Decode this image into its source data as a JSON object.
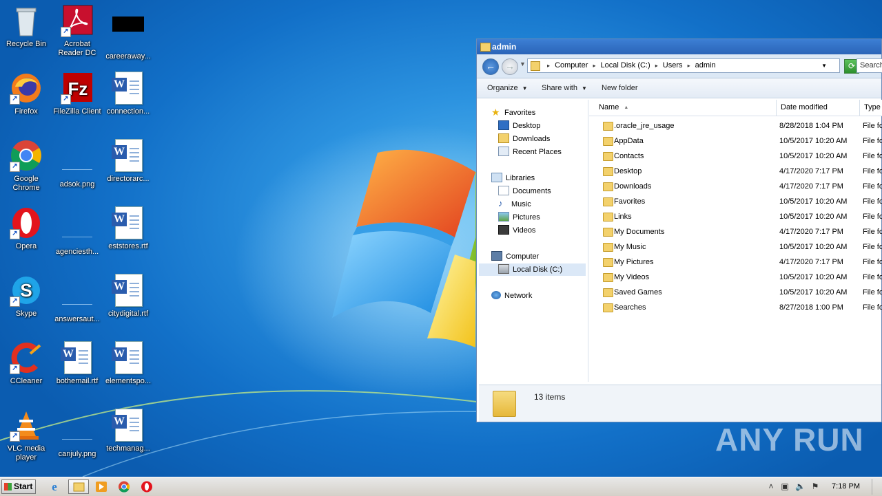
{
  "desktop": {
    "icons": [
      {
        "label": "Recycle Bin"
      },
      {
        "label": "Acrobat Reader DC"
      },
      {
        "label": "careeraway..."
      },
      {
        "label": "Firefox"
      },
      {
        "label": "FileZilla Client"
      },
      {
        "label": "connection..."
      },
      {
        "label": "Google Chrome"
      },
      {
        "label": "adsok.png"
      },
      {
        "label": "directorarc..."
      },
      {
        "label": "Opera"
      },
      {
        "label": "agenciesth..."
      },
      {
        "label": "eststores.rtf"
      },
      {
        "label": "Skype"
      },
      {
        "label": "answersaut..."
      },
      {
        "label": "citydigital.rtf"
      },
      {
        "label": "CCleaner"
      },
      {
        "label": "bothemail.rtf"
      },
      {
        "label": "elementspo..."
      },
      {
        "label": "VLC media player"
      },
      {
        "label": "canjuly.png"
      },
      {
        "label": "techmanag..."
      }
    ]
  },
  "explorer": {
    "title": "admin",
    "breadcrumbs": [
      "Computer",
      "Local Disk (C:)",
      "Users",
      "admin"
    ],
    "search_placeholder": "Search",
    "toolbar": {
      "organize": "Organize",
      "share_with": "Share with",
      "new_folder": "New folder"
    },
    "nav": {
      "favorites": "Favorites",
      "desktop": "Desktop",
      "downloads": "Downloads",
      "recent_places": "Recent Places",
      "libraries": "Libraries",
      "documents": "Documents",
      "music": "Music",
      "pictures": "Pictures",
      "videos": "Videos",
      "computer": "Computer",
      "local_disk": "Local Disk (C:)",
      "network": "Network"
    },
    "columns": {
      "name": "Name",
      "date_modified": "Date modified",
      "type": "Type"
    },
    "files": [
      {
        "name": ".oracle_jre_usage",
        "date": "8/28/2018 1:04 PM",
        "type": "File fo"
      },
      {
        "name": "AppData",
        "date": "10/5/2017 10:20 AM",
        "type": "File fo"
      },
      {
        "name": "Contacts",
        "date": "10/5/2017 10:20 AM",
        "type": "File fo"
      },
      {
        "name": "Desktop",
        "date": "4/17/2020 7:17 PM",
        "type": "File fo"
      },
      {
        "name": "Downloads",
        "date": "4/17/2020 7:17 PM",
        "type": "File fo"
      },
      {
        "name": "Favorites",
        "date": "10/5/2017 10:20 AM",
        "type": "File fo"
      },
      {
        "name": "Links",
        "date": "10/5/2017 10:20 AM",
        "type": "File fo"
      },
      {
        "name": "My Documents",
        "date": "4/17/2020 7:17 PM",
        "type": "File fo"
      },
      {
        "name": "My Music",
        "date": "10/5/2017 10:20 AM",
        "type": "File fo"
      },
      {
        "name": "My Pictures",
        "date": "4/17/2020 7:17 PM",
        "type": "File fo"
      },
      {
        "name": "My Videos",
        "date": "10/5/2017 10:20 AM",
        "type": "File fo"
      },
      {
        "name": "Saved Games",
        "date": "10/5/2017 10:20 AM",
        "type": "File fo"
      },
      {
        "name": "Searches",
        "date": "8/27/2018 1:00 PM",
        "type": "File fo"
      }
    ],
    "status": "13 items"
  },
  "watermark": "ANY RUN",
  "taskbar": {
    "start_label": "Start",
    "clock": "7:18 PM"
  }
}
